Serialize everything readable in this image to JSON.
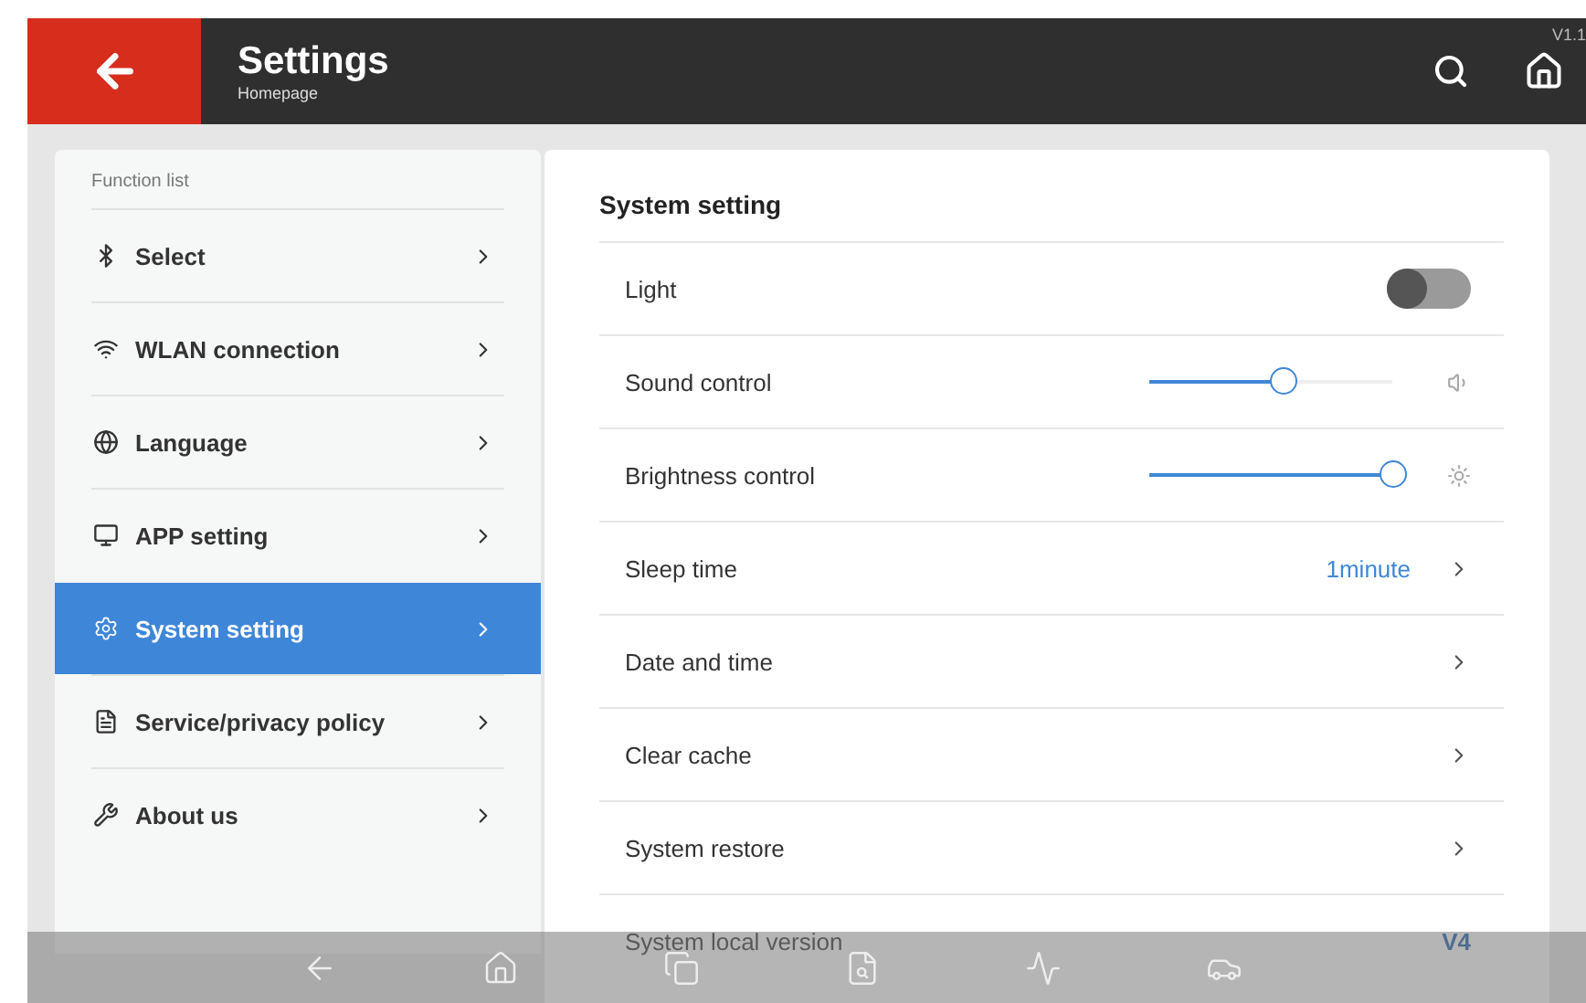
{
  "header": {
    "title": "Settings",
    "subtitle": "Homepage",
    "version": "V1.1"
  },
  "sidebar": {
    "title": "Function list",
    "items": [
      {
        "label": "Select",
        "selected": false
      },
      {
        "label": "WLAN connection",
        "selected": false
      },
      {
        "label": "Language",
        "selected": false
      },
      {
        "label": "APP setting",
        "selected": false
      },
      {
        "label": "System setting",
        "selected": true
      },
      {
        "label": "Service/privacy policy",
        "selected": false
      },
      {
        "label": "About us",
        "selected": false
      }
    ]
  },
  "panel": {
    "title": "System setting",
    "rows": [
      {
        "kind": "toggle",
        "label": "Light",
        "on": false
      },
      {
        "kind": "slider",
        "label": "Sound control",
        "level": 0.55
      },
      {
        "kind": "slider",
        "label": "Brightness control",
        "level": 1
      },
      {
        "kind": "link",
        "label": "Sleep time",
        "value": "1minute"
      },
      {
        "kind": "link",
        "label": "Date and time"
      },
      {
        "kind": "link",
        "label": "Clear cache"
      },
      {
        "kind": "link",
        "label": "System restore"
      },
      {
        "kind": "info",
        "label": "System local version",
        "value": "V4"
      }
    ]
  }
}
